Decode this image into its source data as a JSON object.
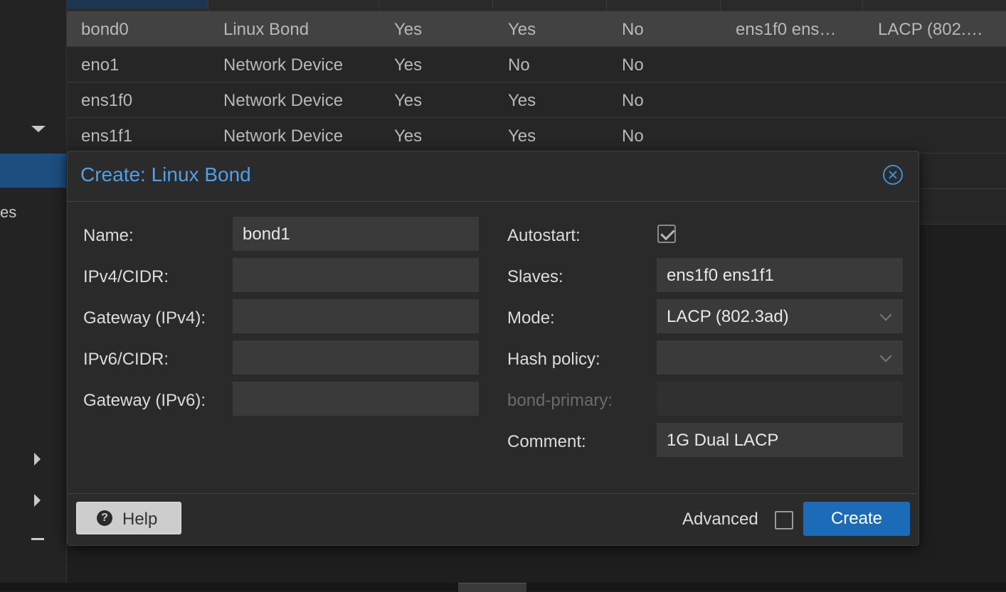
{
  "sidebar": {
    "fragment_text": "es"
  },
  "grid_rows": [
    {
      "name": "bond0",
      "type": "Linux Bond",
      "active": "Yes",
      "autostart": "Yes",
      "vlan_aware": "No",
      "ports": "ens1f0 ens…",
      "bond_mode": "LACP (802.…"
    },
    {
      "name": "eno1",
      "type": "Network Device",
      "active": "Yes",
      "autostart": "No",
      "vlan_aware": "No",
      "ports": "",
      "bond_mode": ""
    },
    {
      "name": "ens1f0",
      "type": "Network Device",
      "active": "Yes",
      "autostart": "Yes",
      "vlan_aware": "No",
      "ports": "",
      "bond_mode": ""
    },
    {
      "name": "ens1f1",
      "type": "Network Device",
      "active": "Yes",
      "autostart": "Yes",
      "vlan_aware": "No",
      "ports": "",
      "bond_mode": ""
    }
  ],
  "dialog": {
    "title": "Create: Linux Bond",
    "left": {
      "name_label": "Name:",
      "name_value": "bond1",
      "ipv4_label": "IPv4/CIDR:",
      "ipv4_value": "",
      "gw4_label": "Gateway (IPv4):",
      "gw4_value": "",
      "ipv6_label": "IPv6/CIDR:",
      "ipv6_value": "",
      "gw6_label": "Gateway (IPv6):",
      "gw6_value": ""
    },
    "right": {
      "autostart_label": "Autostart:",
      "autostart_checked": true,
      "slaves_label": "Slaves:",
      "slaves_value": "ens1f0 ens1f1",
      "mode_label": "Mode:",
      "mode_value": "LACP (802.3ad)",
      "hash_label": "Hash policy:",
      "hash_value": "",
      "primary_label": "bond-primary:",
      "primary_value": "",
      "comment_label": "Comment:",
      "comment_value": "1G Dual LACP"
    },
    "footer": {
      "help_label": "Help",
      "advanced_label": "Advanced",
      "advanced_checked": false,
      "create_label": "Create"
    }
  }
}
